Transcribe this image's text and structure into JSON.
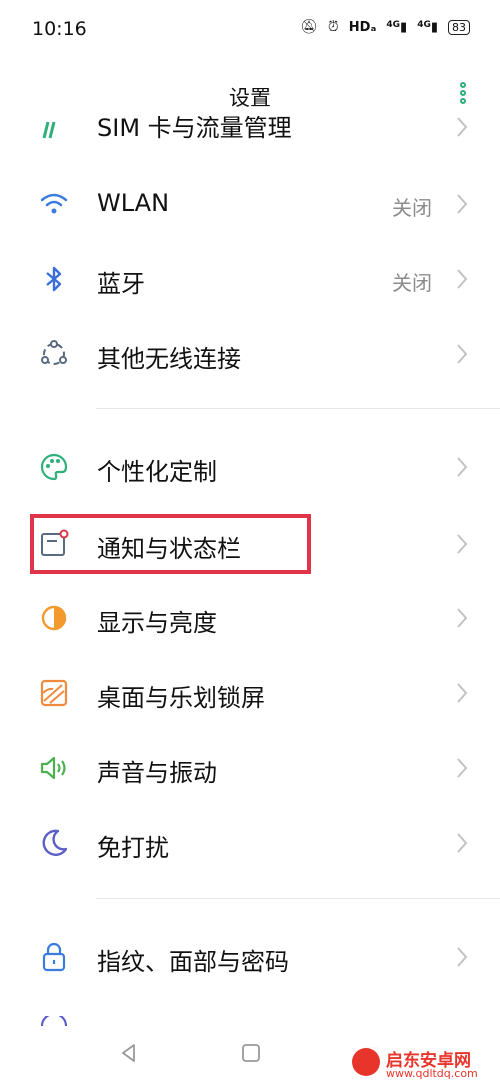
{
  "status": {
    "time": "10:16",
    "hd": "HDₐ",
    "sig1": "4G",
    "sig2": "4G",
    "battery": "83"
  },
  "header": {
    "title": "设置"
  },
  "settings": {
    "partial_top": "SIM 卡与流量管理",
    "items": [
      {
        "label": "WLAN",
        "value": "关闭",
        "icon": "wifi-icon"
      },
      {
        "label": "蓝牙",
        "value": "关闭",
        "icon": "bluetooth-icon"
      },
      {
        "label": "其他无线连接",
        "value": "",
        "icon": "connection-icon"
      },
      {
        "label": "个性化定制",
        "value": "",
        "icon": "palette-icon"
      },
      {
        "label": "通知与状态栏",
        "value": "",
        "icon": "notification-icon"
      },
      {
        "label": "显示与亮度",
        "value": "",
        "icon": "brightness-icon"
      },
      {
        "label": "桌面与乐划锁屏",
        "value": "",
        "icon": "wallpaper-icon"
      },
      {
        "label": "声音与振动",
        "value": "",
        "icon": "speaker-icon"
      },
      {
        "label": "免打扰",
        "value": "",
        "icon": "moon-icon"
      },
      {
        "label": "指纹、面部与密码",
        "value": "",
        "icon": "lock-icon"
      }
    ]
  },
  "watermark": {
    "name": "启东安卓网",
    "url": "www.qdltdq.com"
  },
  "colors": {
    "accent": "#2fb07a",
    "highlight": "#e0344a",
    "wifi": "#3a7be0",
    "bluetooth": "#3a6ed8",
    "palette": "#2fb07a",
    "notification": "#5a6a80",
    "brightness": "#f29a2e",
    "wallpaper": "#f08a3c",
    "speaker": "#4caf50",
    "moon": "#5b5fc7",
    "lock": "#3a7be0"
  }
}
